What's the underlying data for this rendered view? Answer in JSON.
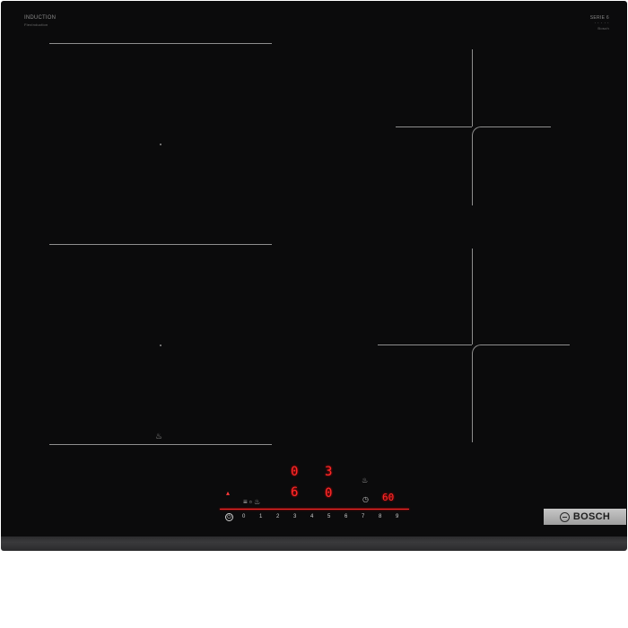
{
  "labels": {
    "top_left_title": "INDUCTION",
    "top_left_sub": "FlexInduction",
    "top_right_line1": "SERIE 6",
    "top_right_line2": "· · · · ·",
    "top_right_sub": "Bosch"
  },
  "displays": {
    "zone_top_left": "0",
    "zone_top_right": "3",
    "zone_bottom_left": "6",
    "zone_bottom_right": "0",
    "timer": "60"
  },
  "slider": {
    "steps": [
      "0",
      "1",
      "2",
      "3",
      "4",
      "5",
      "6",
      "7",
      "8",
      "9"
    ]
  },
  "brand": {
    "name": "BOSCH"
  },
  "colors": {
    "glass": "#0b0b0c",
    "display_red": "#ff2a2a",
    "zone_lines": "#8e8e8e"
  }
}
